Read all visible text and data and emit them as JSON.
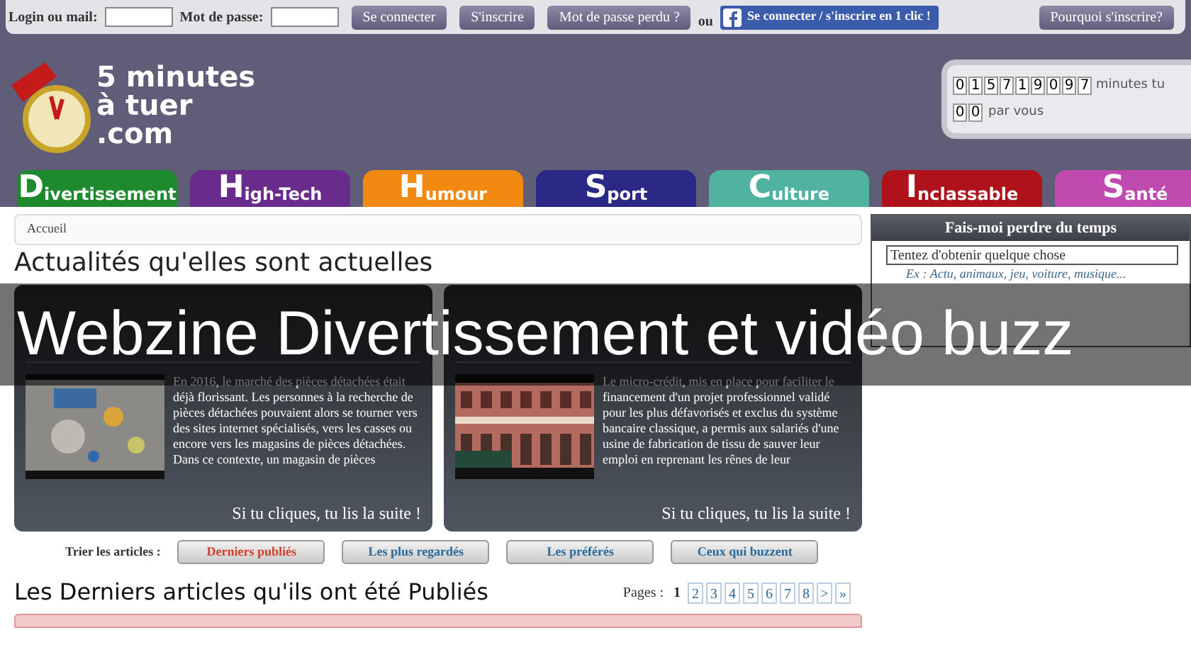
{
  "login_bar": {
    "login_label": "Login ou mail:",
    "password_label": "Mot de passe:",
    "buttons": [
      "Se connecter",
      "S'inscrire",
      "Mot de passe perdu ?"
    ],
    "or": "ou",
    "facebook_button": "Se connecter / s'inscrire en 1 clic !",
    "why_button": "Pourquoi s'inscrire?"
  },
  "logo": {
    "lines": [
      "5 minutes",
      "à tuer",
      ".com"
    ]
  },
  "counter": {
    "total_digits": [
      "0",
      "1",
      "5",
      "7",
      "1",
      "9",
      "0",
      "9",
      "7"
    ],
    "total_label": "minutes tu",
    "yours_digits": [
      "0",
      "0"
    ],
    "yours_label": "par vous"
  },
  "nav_tabs": [
    {
      "initial": "D",
      "rest": "ivertissement",
      "color": "#1e8a2e"
    },
    {
      "initial": "H",
      "rest": "igh-Tech",
      "color": "#6a2c8c"
    },
    {
      "initial": "H",
      "rest": "umour",
      "color": "#f28a12"
    },
    {
      "initial": "S",
      "rest": "port",
      "color": "#2a2a86"
    },
    {
      "initial": "C",
      "rest": "ulture",
      "color": "#4fb3a0"
    },
    {
      "initial": "I",
      "rest": "nclassable",
      "color": "#b0121c"
    },
    {
      "initial": "S",
      "rest": "anté",
      "color": "#c04ab0"
    }
  ],
  "breadcrumb": [
    "Accueil"
  ],
  "section_title": "Actualités qu'elles sont actuelles",
  "articles": [
    {
      "text": "En 2016, le marché des pièces détachées était déjà florissant. Les personnes à la recherche de pièces détachées pouvaient alors se tourner vers des sites internet spécialisés, vers les casses ou encore vers les magasins de pièces détachées. Dans ce contexte, un magasin de pièces",
      "link": "Si tu cliques, tu lis la suite !",
      "kind": "parts"
    },
    {
      "text": "Le micro-crédit, mis en place pour faciliter le financement d'un projet professionnel validé pour les plus défavorisés et exclus du système bancaire classique, a permis aux salariés d'une usine de fabrication de tissu de sauver leur emploi en reprenant les rênes de leur",
      "link": "Si tu cliques, tu lis la suite !",
      "kind": "building"
    }
  ],
  "sidebar": {
    "title": "Fais-moi perdre du temps",
    "search_value": "Tentez d'obtenir quelque chose",
    "hint": "Ex : Actu, animaux, jeu, voiture, musique..."
  },
  "sort": {
    "label": "Trier les articles :",
    "options": [
      {
        "label": "Derniers publiés",
        "selected": true
      },
      {
        "label": "Les plus regardés",
        "selected": false
      },
      {
        "label": "Les préférés",
        "selected": false
      },
      {
        "label": "Ceux qui buzzent",
        "selected": false
      }
    ]
  },
  "latest_title": "Les Derniers articles qu'ils ont été Publiés",
  "pagination": {
    "label": "Pages :",
    "pages": [
      {
        "label": "1",
        "selected": true
      },
      {
        "label": "2",
        "selected": false
      },
      {
        "label": "3",
        "selected": false
      },
      {
        "label": "4",
        "selected": false
      },
      {
        "label": "5",
        "selected": false
      },
      {
        "label": "6",
        "selected": false
      },
      {
        "label": "7",
        "selected": false
      },
      {
        "label": "8",
        "selected": false
      },
      {
        "label": ">",
        "selected": false
      },
      {
        "label": "»",
        "selected": false
      }
    ]
  },
  "banner": {
    "title": "Webzine Divertissement et vidéo buzz"
  }
}
